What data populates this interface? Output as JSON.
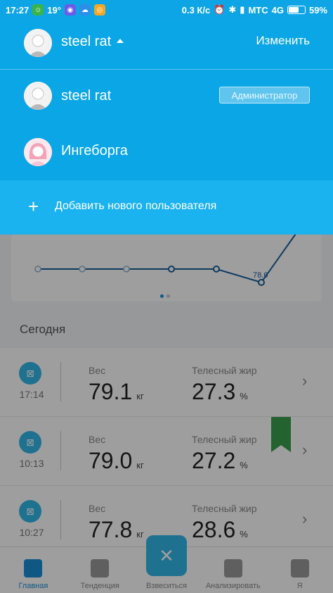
{
  "status_bar": {
    "time": "17:27",
    "temp": "19°",
    "speed": "0.3 К/с",
    "carrier": "МТС",
    "network": "4G",
    "battery": "59%",
    "battery_level": 0.59
  },
  "header": {
    "current_user": "steel rat",
    "edit_label": "Изменить"
  },
  "users": [
    {
      "name": "steel rat",
      "badge": "Администратор",
      "avatar": "male-avatar-icon"
    },
    {
      "name": "Ингеборга",
      "avatar": "female-avatar-icon"
    }
  ],
  "add_user": {
    "label": "Добавить нового пользователя",
    "icon": "plus-icon"
  },
  "chart": {
    "visible_label": "78.6"
  },
  "today_section": {
    "title": "Сегодня"
  },
  "records": [
    {
      "time": "17:14",
      "weight_label": "Вес",
      "weight": "79.1",
      "weight_unit": "кг",
      "fat_label": "Телесный жир",
      "fat": "27.3",
      "fat_unit": "%"
    },
    {
      "time": "10:13",
      "weight_label": "Вес",
      "weight": "79.0",
      "weight_unit": "кг",
      "fat_label": "Телесный жир",
      "fat": "27.2",
      "fat_unit": "%"
    },
    {
      "time": "10:27",
      "weight_label": "Вес",
      "weight": "77.8",
      "weight_unit": "кг",
      "fat_label": "Телесный жир",
      "fat": "28.6",
      "fat_unit": "%"
    }
  ],
  "bottom_nav": [
    {
      "label": "Главная",
      "icon": "home-icon",
      "active": true
    },
    {
      "label": "Тенденция",
      "icon": "trend-icon"
    },
    {
      "label": "Взвеситься",
      "icon": "scale-icon"
    },
    {
      "label": "Анализировать",
      "icon": "analyze-icon"
    },
    {
      "label": "Я",
      "icon": "profile-icon"
    }
  ],
  "colors": {
    "panel": "#0aa6e6",
    "add_row": "#1ab2ef",
    "accent": "#1a8fd6"
  }
}
